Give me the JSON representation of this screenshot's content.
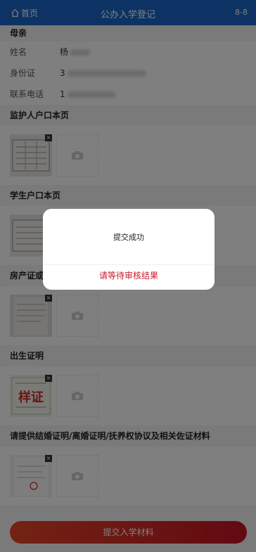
{
  "header": {
    "home_label": "首页",
    "title": "公办入学登记",
    "page_num": "8-8"
  },
  "mother": {
    "section_title": "母亲",
    "fields": [
      {
        "label": "姓名",
        "value_prefix": "杨"
      },
      {
        "label": "身份证",
        "value_prefix": "3"
      },
      {
        "label": "联系电话",
        "value_prefix": "1"
      }
    ]
  },
  "sections": {
    "guardian_hukou": "监护人户口本页",
    "student_hukou": "学生户口本页",
    "property": "房产证或",
    "birth": "出生证明",
    "marriage": "请提供结婚证明/离婚证明/抚养权协议及相关佐证材料"
  },
  "thumbnail_stamp": "样证",
  "submit_label": "提交入学材料",
  "dialog": {
    "message": "提交成功",
    "action_label": "请等待审核结果"
  }
}
